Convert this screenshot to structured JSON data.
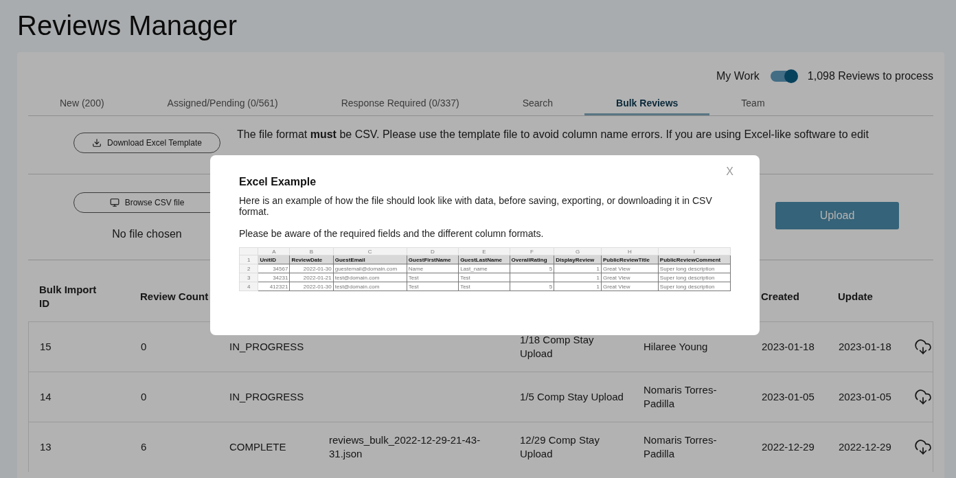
{
  "page_title": "Reviews Manager",
  "my_work": {
    "label": "My Work",
    "on": true,
    "count": "1,098 Reviews to process"
  },
  "tabs": [
    {
      "label": "New (200)",
      "selected": false
    },
    {
      "label": "Assigned/Pending (0/561)",
      "selected": false
    },
    {
      "label": "Response Required (0/337)",
      "selected": false
    },
    {
      "label": "Search",
      "selected": false
    },
    {
      "label": "Bulk Reviews",
      "selected": true
    },
    {
      "label": "Team",
      "selected": false
    }
  ],
  "template": {
    "button": "Download Excel Template",
    "note": "The file format **must** be CSV. Please use the template file to avoid column name errors. If you are using Excel-like software to edit"
  },
  "upload": {
    "browse_button": "Browse CSV file",
    "file_status": "No file chosen",
    "upload_button": "Upload",
    "upload_disabled": true
  },
  "table": {
    "columns": [
      "Bulk Import ID",
      "Review Count",
      "Created",
      "Update"
    ],
    "rows": [
      {
        "id": "15",
        "count": "0",
        "status": "IN_PROGRESS",
        "name": "1/18 Comp Stay Upload",
        "user": "Hilaree Young",
        "created": "2023-01-18",
        "updated": "2023-01-18"
      },
      {
        "id": "14",
        "count": "0",
        "status": "IN_PROGRESS",
        "name": "1/5 Comp Stay Upload",
        "user": "Nomaris Torres-Padilla",
        "created": "2023-01-05",
        "updated": "2023-01-05"
      },
      {
        "id": "13",
        "count": "6",
        "status": "COMPLETE",
        "file": "reviews_bulk_2022-12-29-21-43-31.json",
        "name": "12/29 Comp Stay Upload",
        "user": "Nomaris Torres-Padilla",
        "created": "2022-12-29",
        "updated": "2022-12-29"
      }
    ]
  },
  "modal": {
    "close": "X",
    "title": "Excel Example",
    "text": "Here is an example of how the file should look like with data, before saving, exporting, or downloading it in CSV format.",
    "note": "Please be aware of the required fields and the different column formats.",
    "sheet": {
      "column_letters": [
        "A",
        "B",
        "C",
        "D",
        "E",
        "F",
        "G",
        "H",
        "I"
      ],
      "rows": [
        {
          "number": "1",
          "cells": [
            "UnitID",
            "ReviewDate",
            "GuestEmail",
            "GuestFirstName",
            "GuestLastName",
            "OverallRating",
            "DisplayReview",
            "PublicReviewTitle",
            "PublicReviewComment"
          ]
        },
        {
          "number": "2",
          "cells": [
            "34567",
            "2022-01-30",
            "guestemail@domain.com",
            "Name",
            "Last_name",
            "5",
            "1",
            "Great View",
            "Super long description"
          ]
        },
        {
          "number": "3",
          "cells": [
            "34231",
            "2022-01-21",
            "test@domain.com",
            "Test",
            "Test",
            "",
            "1",
            "Great View",
            "Super long description"
          ]
        },
        {
          "number": "4",
          "cells": [
            "412321",
            "2022-01-30",
            "test@domain.com",
            "Test",
            "Test",
            "5",
            "1",
            "Great View",
            "Super long description"
          ]
        }
      ]
    }
  }
}
